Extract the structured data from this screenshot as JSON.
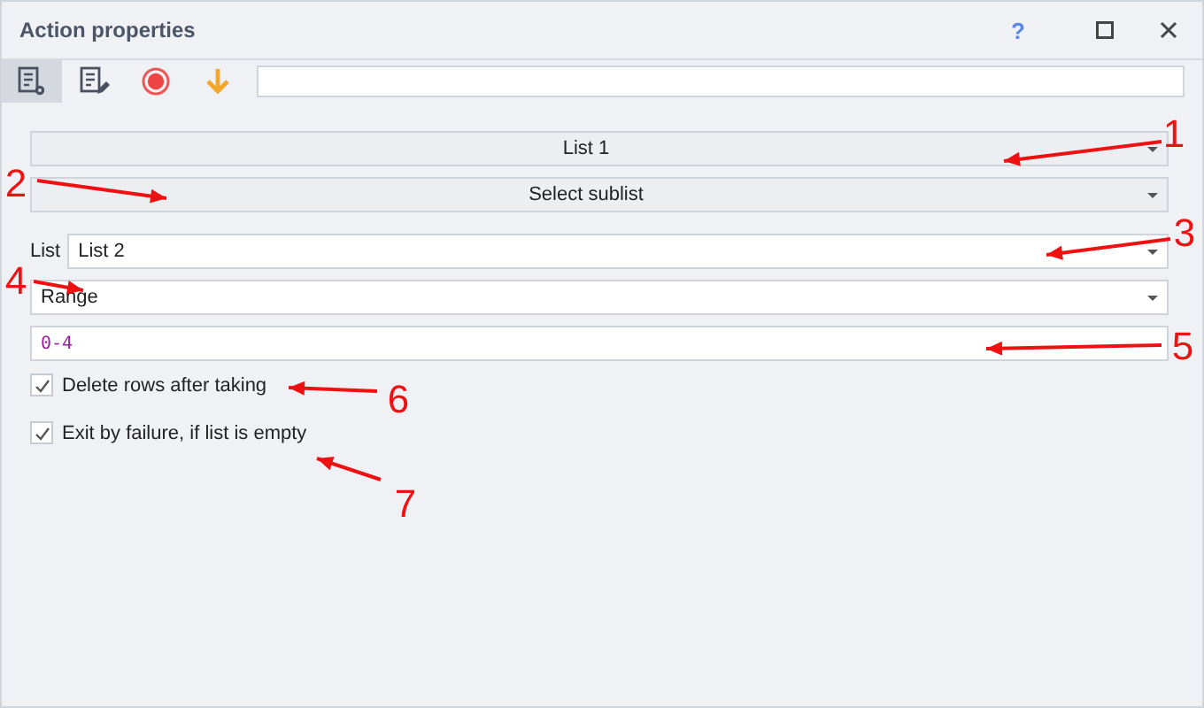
{
  "window": {
    "title": "Action properties",
    "help": "?"
  },
  "toolbar": [
    {
      "kind": "properties",
      "selected": true
    },
    {
      "kind": "edit",
      "selected": false
    },
    {
      "kind": "record",
      "selected": false
    },
    {
      "kind": "down",
      "selected": false
    }
  ],
  "list_dropdown": {
    "value": "List 1"
  },
  "action_dropdown": {
    "value": "Select sublist"
  },
  "list_field": {
    "label": "List",
    "value": "List 2"
  },
  "mode_dropdown": {
    "value": "Range"
  },
  "range_field": {
    "value": "0-4"
  },
  "options": [
    {
      "label": "Delete rows after taking",
      "checked": true
    },
    {
      "label": "Exit by failure, if list is empty",
      "checked": true
    }
  ],
  "annotations": [
    {
      "label": "1"
    },
    {
      "label": "2"
    },
    {
      "label": "3"
    },
    {
      "label": "4"
    },
    {
      "label": "5"
    },
    {
      "label": "6"
    },
    {
      "label": "7"
    }
  ]
}
